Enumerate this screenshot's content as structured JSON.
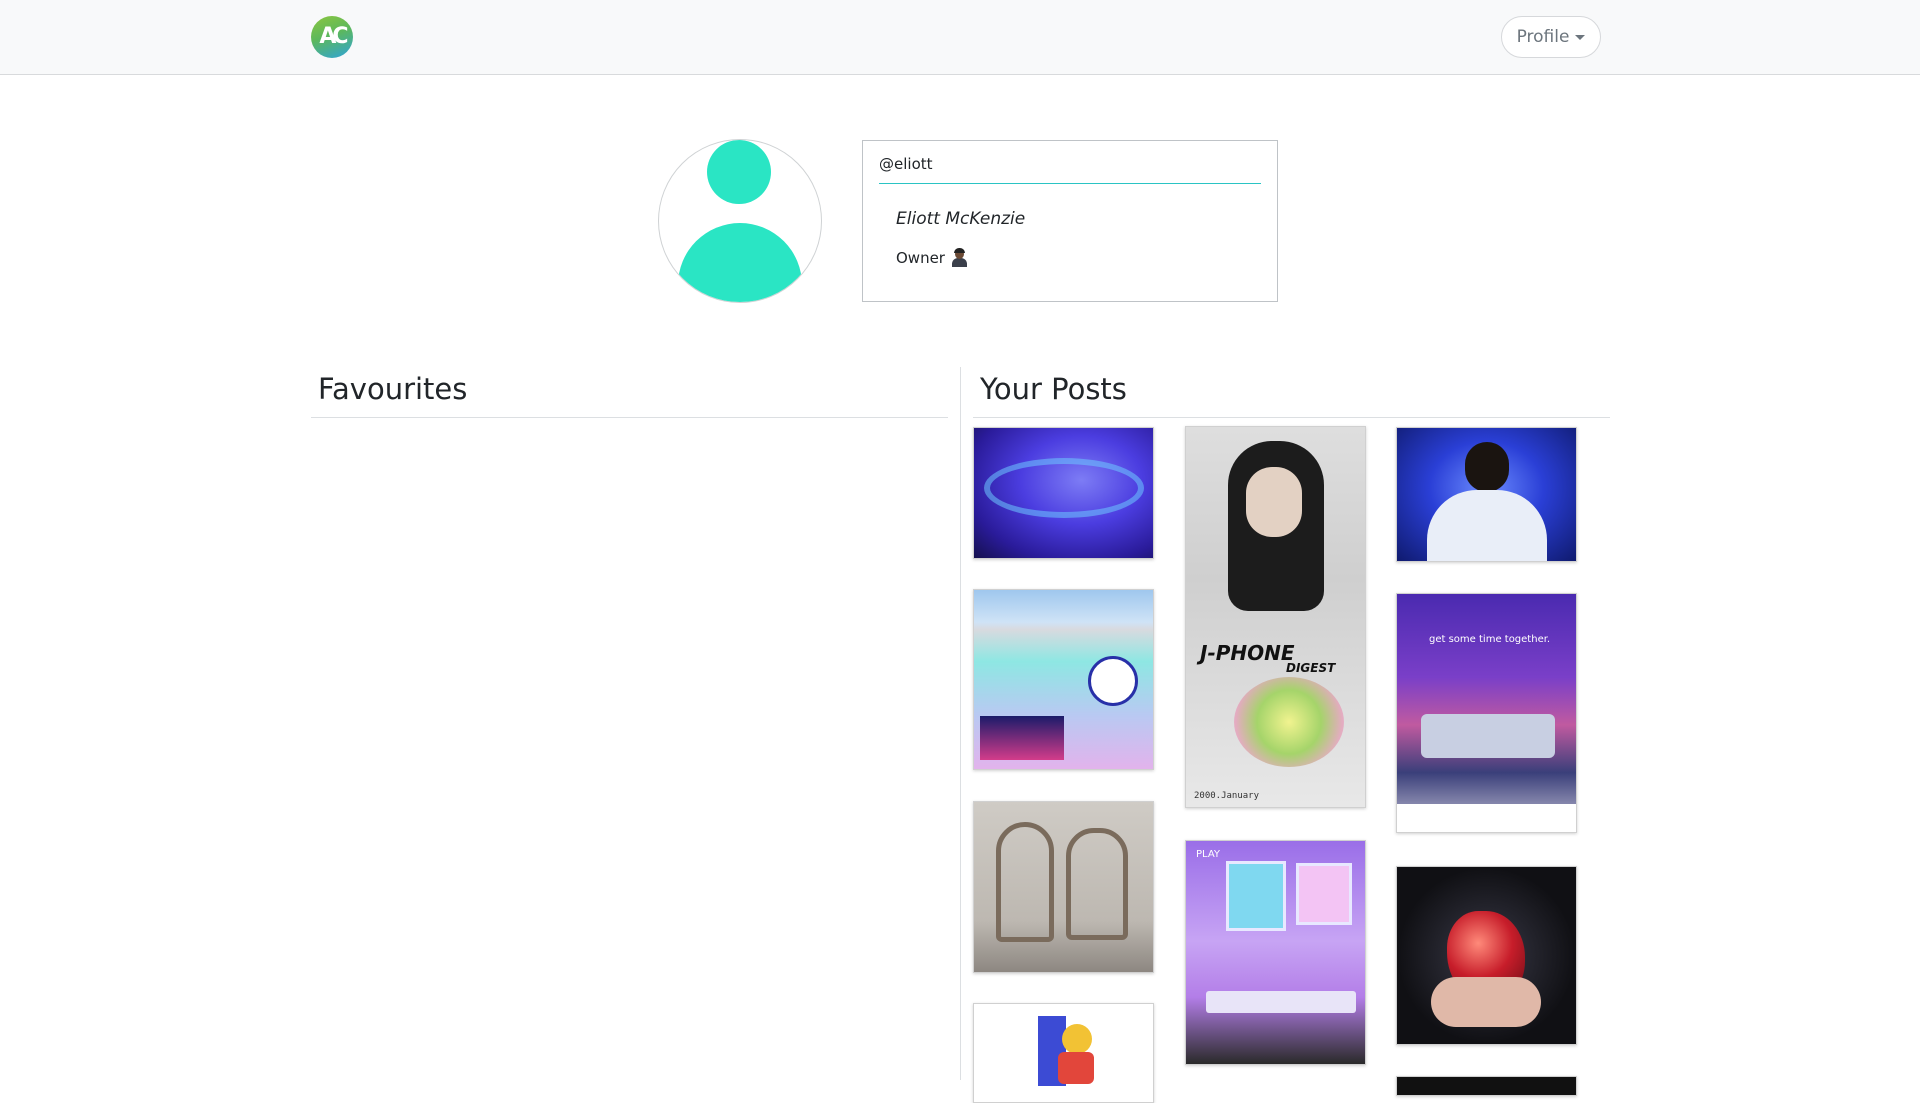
{
  "navbar": {
    "logo_text": "AC",
    "profile_label": "Profile"
  },
  "profile": {
    "username": "@eliott",
    "full_name": "Eliott McKenzie",
    "role": "Owner",
    "role_icon": "person-emoji-icon",
    "avatar_color": "#2ae5c4"
  },
  "sections": {
    "favourites_title": "Favourites",
    "posts_title": "Your Posts"
  },
  "posts": {
    "p1": {
      "desc": "purple futuristic tunnel"
    },
    "p2": {
      "desc": "j-phone advertisement",
      "caption": "J-PHONE",
      "sub": "DIGEST",
      "date": "2000.January"
    },
    "p3": {
      "desc": "portrait on blue"
    },
    "p4": {
      "desc": "retro desktop window"
    },
    "p5": {
      "desc": "couple on sofa ad",
      "caption": "get some time together."
    },
    "p6": {
      "desc": "art nouveau chairs"
    },
    "p7": {
      "desc": "vaporwave room",
      "caption": "PLAY"
    },
    "p8": {
      "desc": "hand holding red crystal"
    },
    "p9": {
      "desc": "colorful character"
    },
    "p10": {
      "desc": "dark image"
    }
  }
}
